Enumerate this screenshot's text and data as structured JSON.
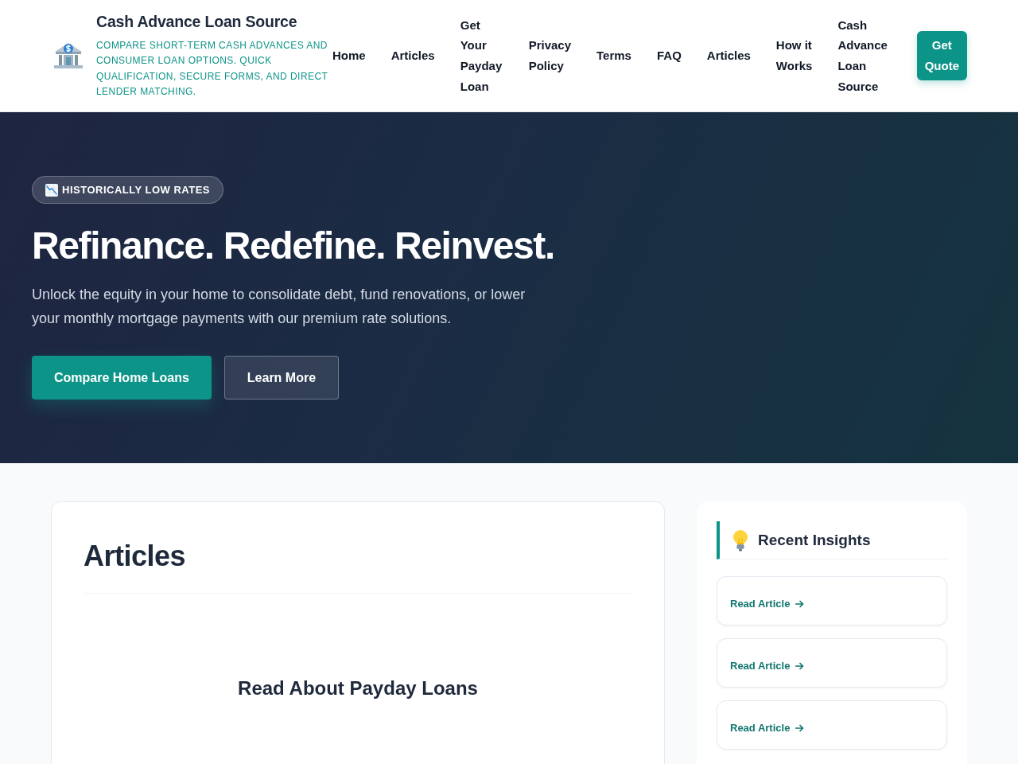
{
  "header": {
    "brand": {
      "name": "Cash Advance Loan Source",
      "tagline": "COMPARE SHORT-TERM CASH ADVANCES AND CONSUMER LOAN OPTIONS. QUICK QUALIFICATION, SECURE FORMS, AND DIRECT LENDER MATCHING."
    },
    "nav": [
      "Home",
      "Articles",
      "Get Your Payday Loan",
      "Privacy Policy",
      "Terms",
      "FAQ",
      "Articles",
      "How it Works",
      "Cash Advance Loan Source"
    ],
    "cta": "Get Quote"
  },
  "hero": {
    "badge": "HISTORICALLY LOW RATES",
    "title": "Refinance. Redefine. Reinvest.",
    "text": "Unlock the equity in your home to consolidate debt, fund renovations, or lower your monthly mortgage payments with our premium rate solutions.",
    "buttons": [
      {
        "label": "Compare Home Loans",
        "kind": "primary"
      },
      {
        "label": "Learn More",
        "kind": "secondary"
      }
    ]
  },
  "articles": {
    "title": "Articles",
    "items": [
      "Read About Payday Loans"
    ]
  },
  "sidebar": {
    "title": "Recent Insights",
    "links": [
      "Read Article",
      "Read Article",
      "Read Article"
    ]
  }
}
